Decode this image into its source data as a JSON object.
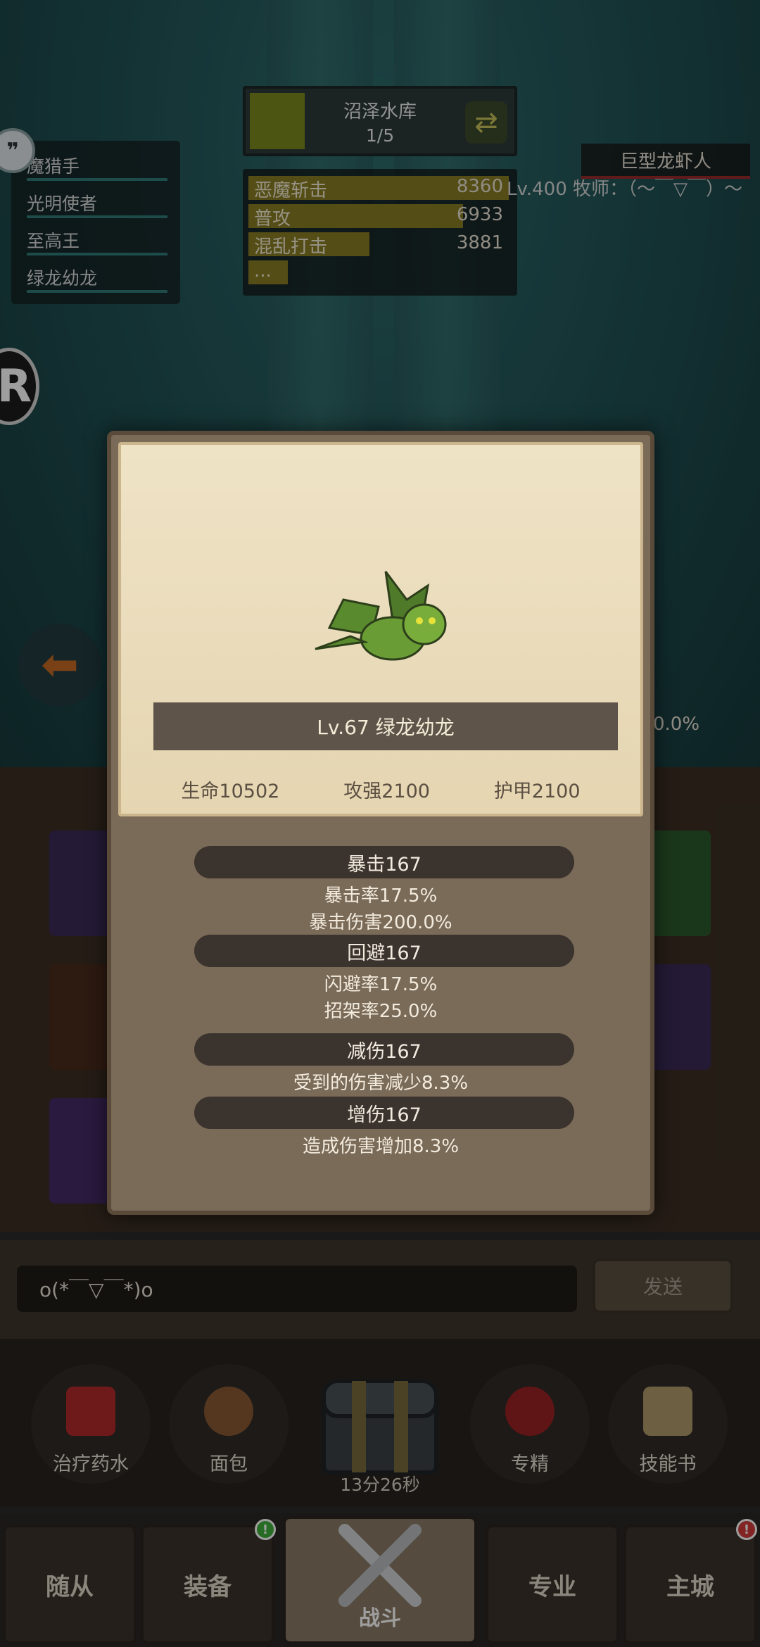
{
  "stage": {
    "name": "沼泽水库",
    "progress": "1/5"
  },
  "team": [
    "魔猎手",
    "光明使者",
    "至高王",
    "绿龙幼龙"
  ],
  "damage": [
    {
      "name": "恶魔斩击",
      "value": "8360"
    },
    {
      "name": "普攻",
      "value": "6933"
    },
    {
      "name": "混乱打击",
      "value": "3881"
    },
    {
      "name": "...",
      "value": ""
    }
  ],
  "enemy": {
    "name": "巨型龙虾人",
    "desc": "Lv.400 牧师：（～￣▽￣）～"
  },
  "right_percent": "0.0%",
  "modal": {
    "title": "Lv.67 绿龙幼龙",
    "base_stats": [
      "生命10502",
      "攻强2100",
      "护甲2100"
    ],
    "sections": [
      {
        "header": "暴击167",
        "lines": [
          "暴击率17.5%",
          "暴击伤害200.0%"
        ]
      },
      {
        "header": "回避167",
        "lines": [
          "闪避率17.5%",
          "招架率25.0%"
        ]
      },
      {
        "header": "减伤167",
        "lines": [
          "受到的伤害减少8.3%"
        ]
      },
      {
        "header": "增伤167",
        "lines": [
          "造成伤害增加8.3%"
        ]
      }
    ]
  },
  "chat": {
    "input_value": "o(*￣▽￣*)o",
    "send_label": "发送"
  },
  "items": [
    "治疗药水",
    "面包",
    "专精",
    "技能书"
  ],
  "chest_timer": "13分26秒",
  "nav": [
    "随从",
    "装备",
    "战斗",
    "专业",
    "主城"
  ],
  "colors": {
    "accent": "#8a7d24",
    "badge_green": "#3fae3a",
    "badge_red": "#d23a3a"
  }
}
